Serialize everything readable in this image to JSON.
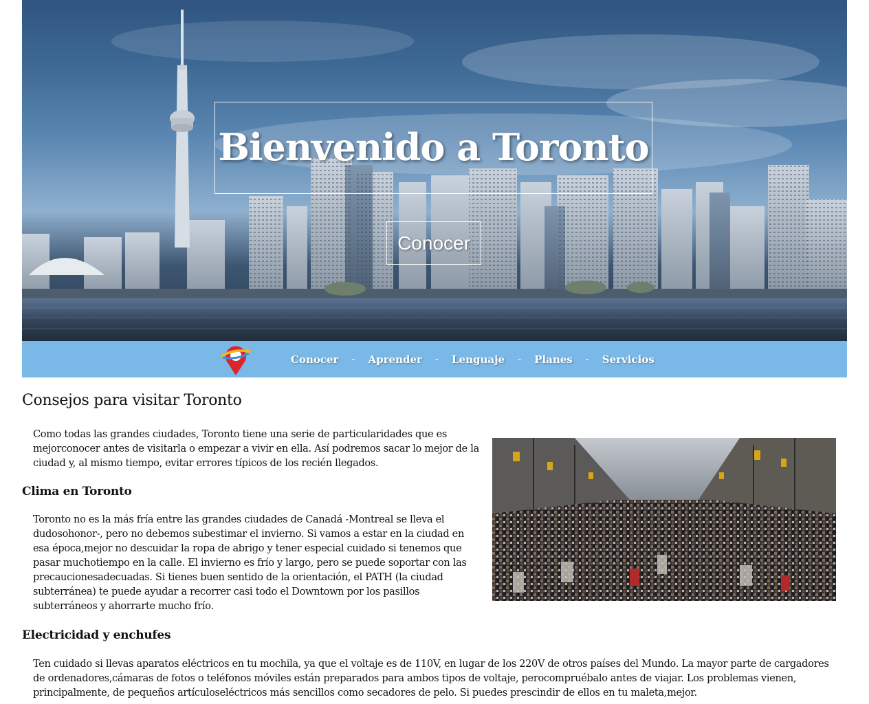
{
  "hero": {
    "title": "Bienvenido a Toronto",
    "button_label": "Conocer"
  },
  "nav": {
    "items": [
      {
        "label": "Conocer"
      },
      {
        "label": "Aprender"
      },
      {
        "label": "Lenguaje"
      },
      {
        "label": "Planes"
      },
      {
        "label": "Servicios"
      }
    ],
    "separator": "-"
  },
  "content": {
    "title": "Consejos para visitar Toronto",
    "intro": "Como todas las grandes ciudades, Toronto tiene una serie de particularidades que es mejorconocer antes de visitarla o empezar a vivir en ella. Así podremos sacar lo mejor de la ciudad y, al mismo tiempo, evitar errores típicos de los recién llegados.",
    "sections": [
      {
        "heading": "Clima en Toronto",
        "text": "Toronto no es la más fría entre las grandes ciudades de Canadá -Montreal se lleva el dudosohonor-, pero no debemos subestimar el invierno. Si vamos a estar en la ciudad en esa época,mejor no descuidar la ropa de abrigo y tener especial cuidado si tenemos que pasar muchotiempo en la calle. El invierno es frío y largo, pero se puede soportar con las precaucionesadecuadas. Si tienes buen sentido de la orientación, el PATH (la ciudad subterránea) te puede ayudar a recorrer casi todo el Downtown por los pasillos subterráneos y ahorrarte mucho frío."
      },
      {
        "heading": "Electricidad y enchufes",
        "text": "Ten cuidado si llevas aparatos eléctricos en tu mochila, ya que el voltaje es de 110V, en lugar de los 220V de otros países del Mundo. La mayor parte de cargadores de ordenadores,cámaras de fotos o teléfonos móviles están preparados para ambos tipos de voltaje, perocompruébalo antes de viajar. Los problemas vienen, principalmente, de pequeños artículoseléctricos más sencillos como secadores de pelo. Si puedes prescindir de ellos en tu maleta,mejor."
      }
    ]
  },
  "colors": {
    "nav_bg": "#79b8e7",
    "logo_red": "#d9262c",
    "logo_yellow": "#f5b51b",
    "logo_blue": "#3a8fd8"
  },
  "icons": {
    "logo": "map-pin-plane-logo"
  }
}
